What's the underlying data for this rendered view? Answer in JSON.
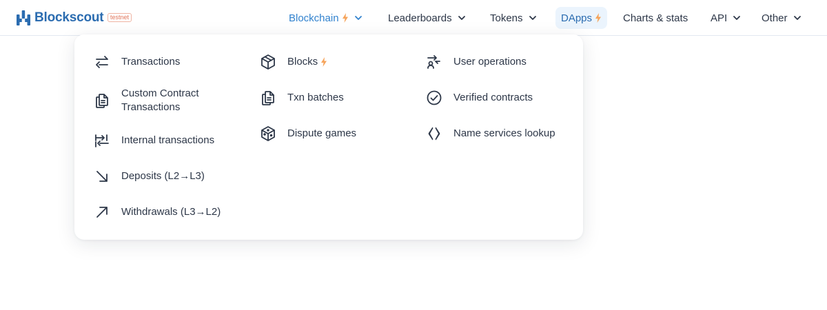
{
  "brand": {
    "name": "Blockscout",
    "badge": "testnet"
  },
  "nav": {
    "blockchain": "Blockchain",
    "leaderboards": "Leaderboards",
    "tokens": "Tokens",
    "dapps": "DApps",
    "charts": "Charts & stats",
    "api": "API",
    "other": "Other"
  },
  "menu": {
    "col1": [
      {
        "label": "Transactions",
        "icon": "transactions-icon"
      },
      {
        "label": "Custom Contract Transactions",
        "icon": "documents-icon"
      },
      {
        "label": "Internal transactions",
        "icon": "internal-transactions-icon"
      },
      {
        "label": "Deposits (L2→L3)",
        "icon": "arrow-down-right-icon"
      },
      {
        "label": "Withdrawals (L3→L2)",
        "icon": "arrow-up-right-icon"
      }
    ],
    "col2": [
      {
        "label": "Blocks",
        "icon": "cube-icon"
      },
      {
        "label": "Txn batches",
        "icon": "documents-icon"
      },
      {
        "label": "Dispute games",
        "icon": "dice-icon"
      }
    ],
    "col3": [
      {
        "label": "User operations",
        "icon": "user-operations-icon"
      },
      {
        "label": "Verified contracts",
        "icon": "check-circle-icon"
      },
      {
        "label": "Name services lookup",
        "icon": "name-services-icon"
      }
    ]
  },
  "colors": {
    "brand": "#2b6cb0",
    "active": "#3182ce",
    "bolt": "#f6a45b",
    "dapps_bg": "#ebf4fd"
  }
}
